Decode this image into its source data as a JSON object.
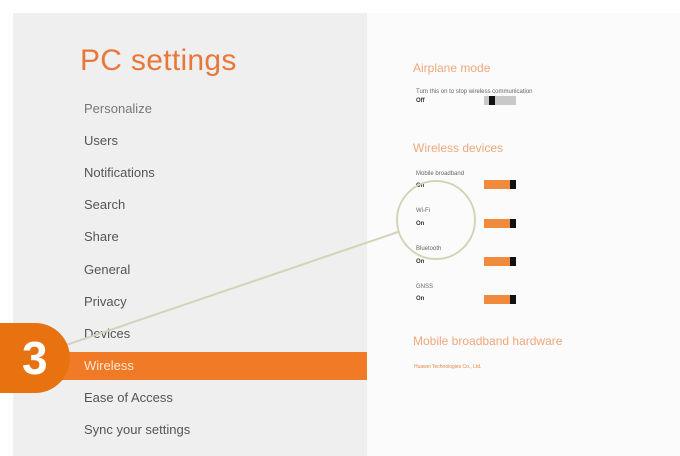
{
  "title": "PC settings",
  "nav": {
    "items": [
      "Personalize",
      "Users",
      "Notifications",
      "Search",
      "Share",
      "General",
      "Privacy",
      "Devices",
      "Wireless",
      "Ease of Access",
      "Sync your settings"
    ],
    "selected": "Wireless"
  },
  "airplane": {
    "heading": "Airplane mode",
    "description": "Turn this on to stop wireless communication",
    "state": "Off",
    "value": false
  },
  "wireless_devices": {
    "heading": "Wireless devices",
    "devices": [
      {
        "label": "Mobile broadband",
        "state": "On",
        "value": true
      },
      {
        "label": "Wi-Fi",
        "state": "On",
        "value": true
      },
      {
        "label": "Bluetooth",
        "state": "On",
        "value": true
      },
      {
        "label": "GNSS",
        "state": "On",
        "value": true
      }
    ]
  },
  "hardware": {
    "heading": "Mobile broadband hardware",
    "link": "Huawei Technologies Co., Ltd."
  },
  "callout": {
    "number": "3"
  },
  "colors": {
    "accent": "#f07a26",
    "heading": "#efa77a",
    "badge": "#e8720f",
    "toggle_off": "#c8c8c8"
  }
}
